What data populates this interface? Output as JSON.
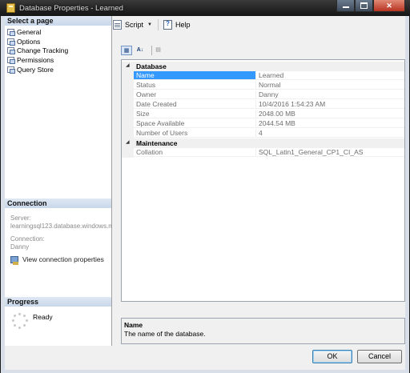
{
  "window": {
    "title": "Database Properties - Learned"
  },
  "left_pane": {
    "select_page_header": "Select a page",
    "pages": [
      "General",
      "Options",
      "Change Tracking",
      "Permissions",
      "Query Store"
    ],
    "connection_header": "Connection",
    "server_label": "Server:",
    "server_value": "learningsql123.database.windows.n",
    "connection_label": "Connection:",
    "connection_value": "Danny",
    "view_connection": "View connection properties",
    "progress_header": "Progress",
    "progress_status": "Ready"
  },
  "toolbar": {
    "script_label": "Script",
    "help_label": "Help"
  },
  "property_grid": {
    "categories": [
      {
        "name": "Database",
        "rows": [
          {
            "name": "Name",
            "value": "Learned"
          },
          {
            "name": "Status",
            "value": "Normal"
          },
          {
            "name": "Owner",
            "value": "Danny"
          },
          {
            "name": "Date Created",
            "value": "10/4/2016 1:54:23 AM"
          },
          {
            "name": "Size",
            "value": "2048.00 MB"
          },
          {
            "name": "Space Available",
            "value": "2044.54 MB"
          },
          {
            "name": "Number of Users",
            "value": "4"
          }
        ]
      },
      {
        "name": "Maintenance",
        "rows": [
          {
            "name": "Collation",
            "value": "SQL_Latin1_General_CP1_CI_AS"
          }
        ]
      }
    ],
    "selected_row": "Name"
  },
  "description": {
    "title": "Name",
    "text": "The name of the database."
  },
  "buttons": {
    "ok": "OK",
    "cancel": "Cancel"
  },
  "colors": {
    "selection": "#3399ff",
    "section_header": "#c8d7ea",
    "chrome": "#1b1b1b"
  }
}
